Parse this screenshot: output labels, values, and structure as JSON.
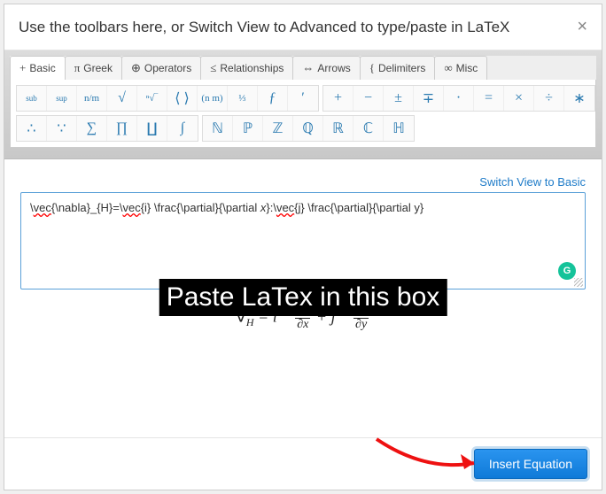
{
  "header": {
    "title": "Use the toolbars here, or Switch View to Advanced to type/paste in LaTeX",
    "close": "×"
  },
  "tabs": [
    {
      "icon": "+",
      "label": "Basic"
    },
    {
      "icon": "π",
      "label": "Greek"
    },
    {
      "icon": "⊕",
      "label": "Operators"
    },
    {
      "icon": "≤",
      "label": "Relationships"
    },
    {
      "icon": "⇔",
      "label": "Arrows"
    },
    {
      "icon": "{",
      "label": "Delimiters"
    },
    {
      "icon": "∞",
      "label": "Misc"
    }
  ],
  "sym_row1_g1": [
    "sub",
    "sup",
    "n/m",
    "√",
    "ⁿ√‾",
    "⟨ ⟩",
    "(n m)",
    "⅓",
    "ƒ",
    "′"
  ],
  "sym_row1_g2": [
    "+",
    "−",
    "±",
    "∓",
    "·",
    "=",
    "×",
    "÷",
    "∗"
  ],
  "sym_row2_g1": [
    "∴",
    "∵",
    "∑",
    "∏",
    "∐",
    "∫"
  ],
  "sym_row2_g2": [
    "ℕ",
    "ℙ",
    "ℤ",
    "ℚ",
    "ℝ",
    "ℂ",
    "ℍ"
  ],
  "editor": {
    "switch_link": "Switch View to Basic",
    "latex_raw": "\\vec{\\nabla}_{H}=\\vec{i} \\frac{\\partial}{\\partial x}:\\vec{j} \\frac{\\partial}{\\partial y}",
    "placeholder": "",
    "overlay": "Paste LaTex in this box"
  },
  "preview": {
    "html_label": "rendered-equation"
  },
  "footer": {
    "insert": "Insert Equation"
  }
}
